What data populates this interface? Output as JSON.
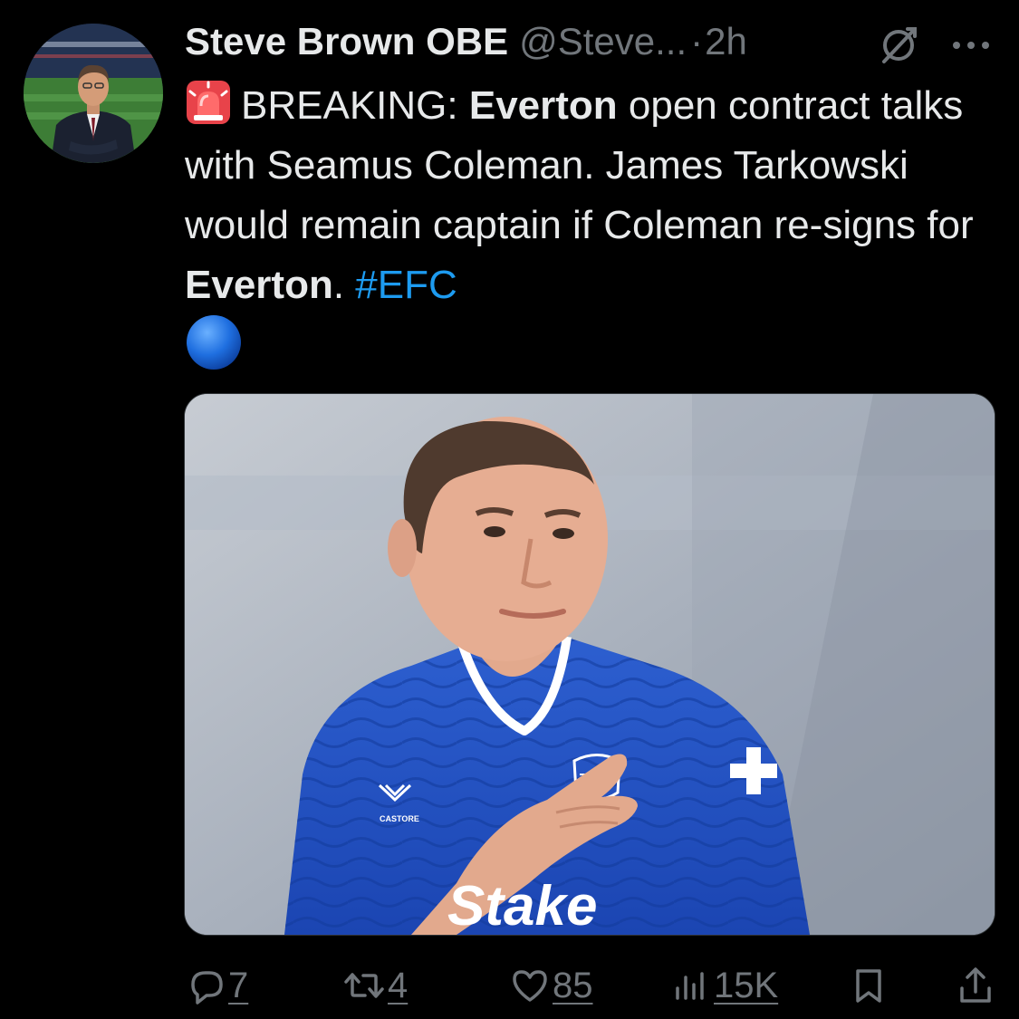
{
  "tweet": {
    "author": {
      "display_name": "Steve Brown OBE",
      "handle": "@Steve...",
      "avatar_icon": "profile-photo"
    },
    "separator": "·",
    "time": "2h",
    "icons": {
      "grok": "grok-icon",
      "more": "more-icon"
    },
    "text": {
      "part1": "BREAKING: ",
      "bold1": "Everton",
      "part2": " open contract talks with Seamus Coleman. James Tarkowski would remain captain if Coleman re-signs for ",
      "bold2": "Everton",
      "part3": ". ",
      "hashtag": "#EFC"
    },
    "emoji": {
      "leading": "rotating-light",
      "trailing": "blue-circle"
    },
    "media": {
      "type": "photo",
      "sponsor_text": "Stake",
      "kit_maker_text": "CASTORE"
    },
    "metrics": {
      "replies": "7",
      "reposts": "4",
      "likes": "85",
      "views": "15K"
    },
    "colors": {
      "background": "#000000",
      "text": "#e7e9ea",
      "secondary": "#71767b",
      "link": "#1d9bf0"
    }
  }
}
